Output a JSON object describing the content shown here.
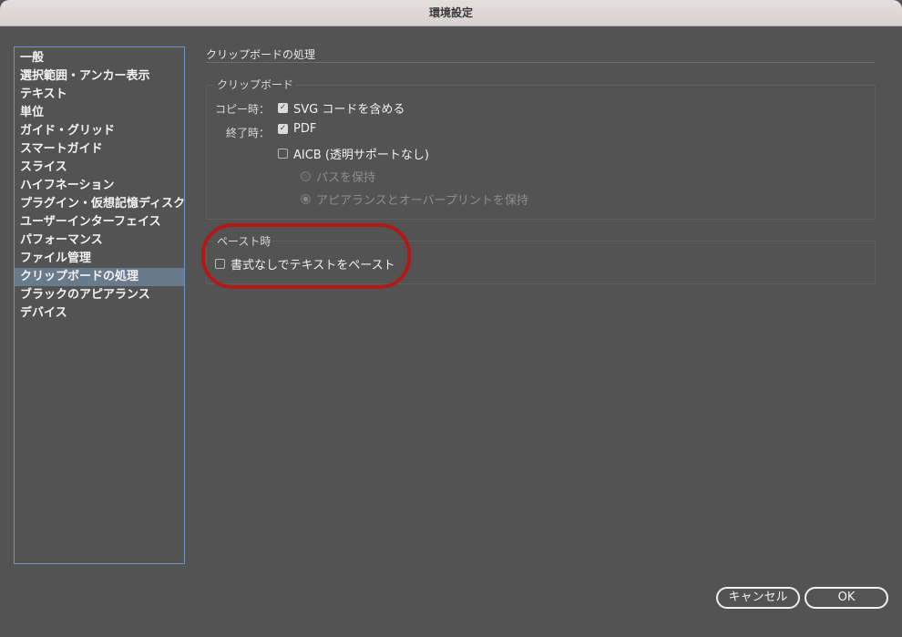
{
  "window": {
    "title": "環境設定"
  },
  "sidebar": {
    "items": [
      {
        "label": "一般"
      },
      {
        "label": "選択範囲・アンカー表示"
      },
      {
        "label": "テキスト"
      },
      {
        "label": "単位"
      },
      {
        "label": "ガイド・グリッド"
      },
      {
        "label": "スマートガイド"
      },
      {
        "label": "スライス"
      },
      {
        "label": "ハイフネーション"
      },
      {
        "label": "プラグイン・仮想記憶ディスク"
      },
      {
        "label": "ユーザーインターフェイス"
      },
      {
        "label": "パフォーマンス"
      },
      {
        "label": "ファイル管理"
      },
      {
        "label": "クリップボードの処理"
      },
      {
        "label": "ブラックのアピアランス"
      },
      {
        "label": "デバイス"
      }
    ],
    "selected_index": 12
  },
  "main": {
    "section_title": "クリップボードの処理",
    "clipboard_group": {
      "label": "クリップボード",
      "copy_label": "コピー時：",
      "svg_option": {
        "label": "SVG コードを含める",
        "checked": true
      },
      "exit_label": "終了時：",
      "pdf_option": {
        "label": "PDF",
        "checked": true
      },
      "aicb_option": {
        "label": "AICB (透明サポートなし)",
        "checked": false
      },
      "preserve_paths": {
        "label": "パスを保持",
        "selected": false,
        "enabled": false
      },
      "preserve_appearance": {
        "label": "アピアランスとオーバープリントを保持",
        "selected": true,
        "enabled": false
      }
    },
    "paste_group": {
      "label": "ペースト時",
      "plain_text_option": {
        "label": "書式なしでテキストをペースト",
        "checked": false
      }
    }
  },
  "buttons": {
    "cancel": "キャンセル",
    "ok": "OK"
  },
  "colors": {
    "background": "#535353",
    "sidebar_border": "#6f94c8",
    "selection": "#6a7a8d",
    "highlight_annotation": "#b21818"
  }
}
